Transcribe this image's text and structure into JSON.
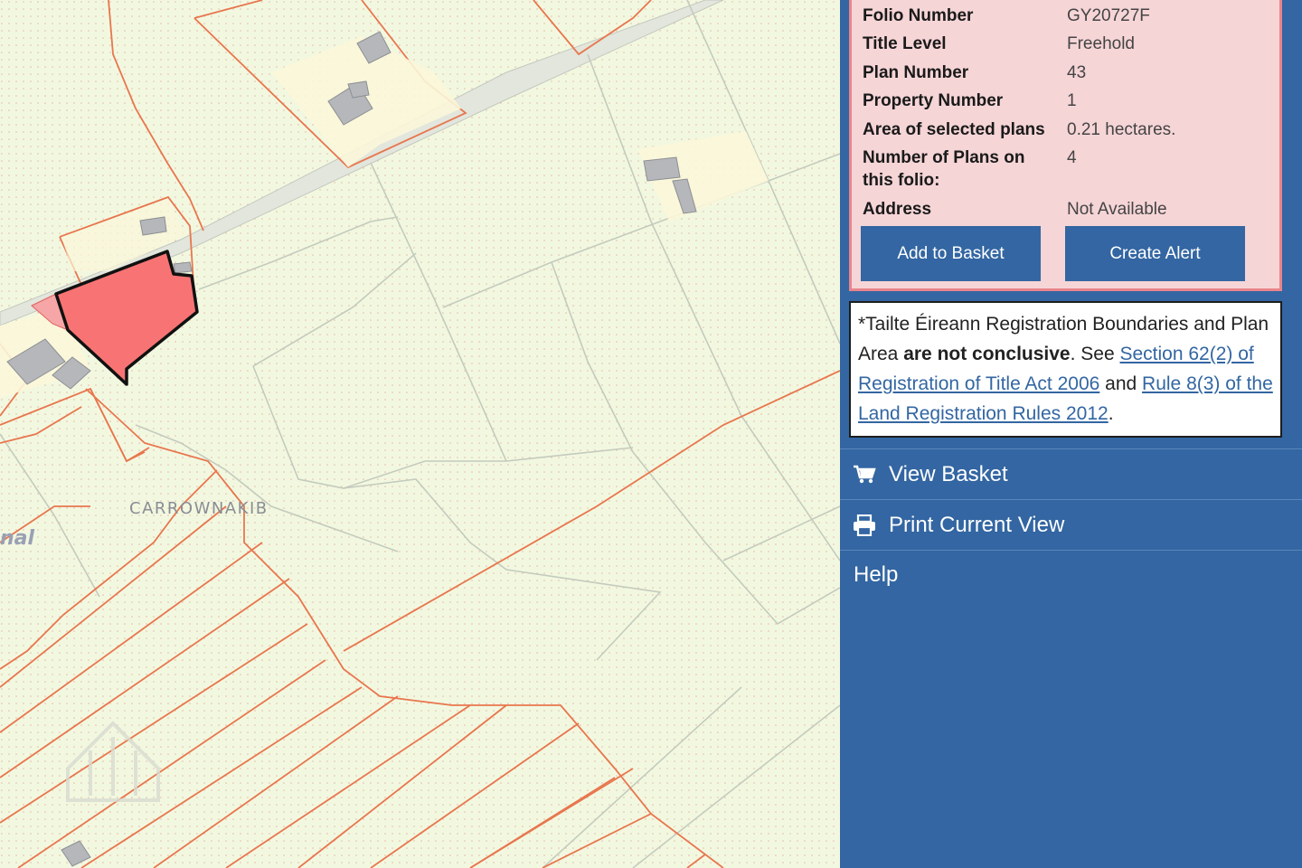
{
  "map": {
    "place_label": "CARROWNAKIB",
    "partial_label": "nal"
  },
  "folio": {
    "rows": [
      {
        "label": "Folio Number",
        "value": "GY20727F"
      },
      {
        "label": "Title Level",
        "value": "Freehold"
      },
      {
        "label": "Plan Number",
        "value": "43"
      },
      {
        "label": "Property Number",
        "value": "1"
      },
      {
        "label": "Area of selected plans",
        "value": "0.21 hectares."
      },
      {
        "label": "Number of Plans on this folio:",
        "value": "4"
      },
      {
        "label": "Address",
        "value": "Not Available"
      }
    ],
    "add_to_basket": "Add to Basket",
    "create_alert": "Create Alert"
  },
  "notice": {
    "part1": "*Tailte Éireann Registration Boundaries and Plan Area ",
    "bold": "are not conclusive",
    "part2": ". See ",
    "link1": "Section 62(2) of Registration of Title Act 2006",
    "part3": " and ",
    "link2": "Rule 8(3) of the Land Registration Rules 2012",
    "part4": "."
  },
  "menu": {
    "view_basket": "View Basket",
    "print_view": "Print Current View",
    "help": "Help"
  },
  "colors": {
    "panel_bg": "#3366a2",
    "info_bg": "#f6d5d7",
    "info_border": "#e9848c",
    "selected_parcel": "#f87474",
    "map_bg": "#f2f8e0",
    "boundary": "#e8764e"
  }
}
